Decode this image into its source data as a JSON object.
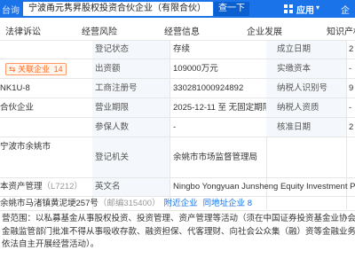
{
  "topbar": {
    "left_text": "台询",
    "search_value": "宁波甬元隽昇股权投资合伙企业（有限合伙）",
    "search_button": "查一下",
    "app_label": "应用",
    "right_text": "企"
  },
  "tabs": [
    "法律诉讼",
    "经营风险",
    "经营信息",
    "企业发展",
    "知识产权"
  ],
  "left_column": {
    "related_company_label": "关联企业",
    "related_company_count": "14",
    "code_fragment": "NK1U-8",
    "company_type": "合伙企业",
    "address_left": "宁波市余姚市",
    "industry": "本资产管理",
    "industry_code": "（L7212）",
    "reg_address": "余姚市马渚镇黄泥埂257号",
    "postcode": "（邮编315400）",
    "nearby_label": "附近企业",
    "same_address_label": "同地址企业",
    "same_address_count": "8"
  },
  "table": {
    "status_label": "登记状态",
    "status_value": "存续",
    "founded_label": "成立日期",
    "founded_value": "2",
    "capital_label": "出资额",
    "capital_value": "109000万元",
    "paid_label": "实缴资本",
    "paid_value": "-",
    "reg_no_label": "工商注册号",
    "reg_no_value": "330281000924892",
    "taxid_label": "纳税人识别号",
    "taxid_value": "9",
    "term_label": "营业期限",
    "term_value": "2025-12-11 至 无固定期限",
    "taxpayer_label": "纳税人资质",
    "taxpayer_value": "-",
    "insured_label": "参保人数",
    "insured_value": "-",
    "approve_label": "核准日期",
    "approve_value": "2",
    "authority_label": "登记机关",
    "authority_value": "余姚市市场监督管理局",
    "english_label": "英文名",
    "english_value": "Ningbo Yongyuan Junsheng Equity Investment Partnership"
  },
  "scope_lines": [
    "营范围：以私募基金从事股权投资、投资管理、资产管理等活动（须在中国证券投资基金业协会完成登记备案后",
    "金融监管部门批准不得从事吸收存款、融资担保、代客理财、向社会公众集（融）资等金融业务）。（除依法须",
    "依法自主开展经营活动）。"
  ]
}
